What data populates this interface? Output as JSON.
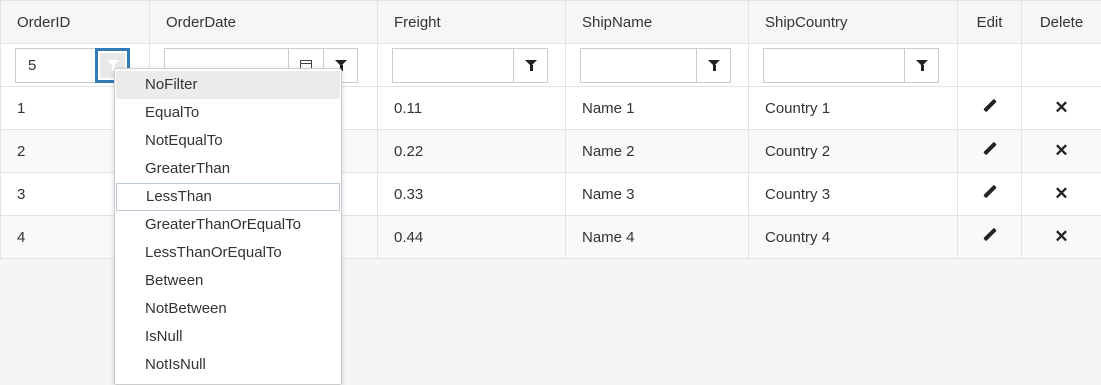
{
  "columns": {
    "order_id": "OrderID",
    "order_date": "OrderDate",
    "freight": "Freight",
    "ship_name": "ShipName",
    "ship_country": "ShipCountry",
    "edit": "Edit",
    "delete": "Delete"
  },
  "filters": {
    "order_id_value": "5",
    "order_date_value": "",
    "freight_value": "",
    "ship_name_value": "",
    "ship_country_value": ""
  },
  "rows": [
    {
      "order_id": "1",
      "freight": "0.11",
      "ship_name": "Name 1",
      "ship_country": "Country 1"
    },
    {
      "order_id": "2",
      "freight": "0.22",
      "ship_name": "Name 2",
      "ship_country": "Country 2"
    },
    {
      "order_id": "3",
      "freight": "0.33",
      "ship_name": "Name 3",
      "ship_country": "Country 3"
    },
    {
      "order_id": "4",
      "freight": "0.44",
      "ship_name": "Name 4",
      "ship_country": "Country 4"
    }
  ],
  "filter_menu": {
    "items": [
      "NoFilter",
      "EqualTo",
      "NotEqualTo",
      "GreaterThan",
      "LessThan",
      "GreaterThanOrEqualTo",
      "LessThanOrEqualTo",
      "Between",
      "NotBetween",
      "IsNull",
      "NotIsNull"
    ],
    "hovered": "NoFilter",
    "focused": "LessThan"
  },
  "icons": {
    "filter": "funnel-icon",
    "calendar": "calendar-icon",
    "edit": "pencil-icon",
    "delete": "close-icon"
  },
  "colors": {
    "active_filter": "#337ab7",
    "header_bg": "#f6f6f6",
    "alt_row_bg": "#f9f9f9"
  }
}
